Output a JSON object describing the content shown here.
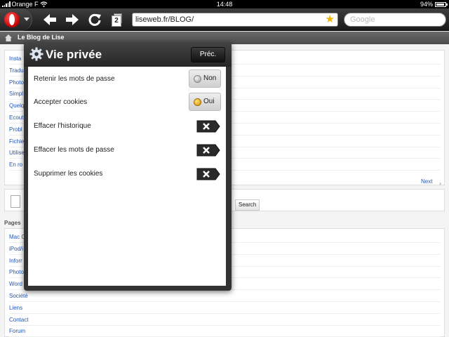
{
  "status_bar": {
    "carrier": "Orange F",
    "time": "14:48",
    "battery": "94%",
    "battery_level": 0.94
  },
  "toolbar": {
    "tab_count": "2",
    "url": "liseweb.fr/BLOG/",
    "search_placeholder": "Google"
  },
  "tabbar": {
    "title": "Le Blog de Lise"
  },
  "page": {
    "links": [
      "Insta",
      "Tradu",
      "Photo",
      "Simpl",
      "Quelq",
      "Ecout",
      "Probl",
      "Fichie",
      "Utilise",
      "En ro"
    ],
    "next_label": "Next",
    "search_button": "Search",
    "pages_heading": "Pages",
    "page_links": [
      "Mac O",
      "iPod/i",
      "Inforr",
      "Photo",
      "Word",
      "Société",
      "Liens",
      "Contact",
      "Forum"
    ]
  },
  "popup": {
    "title": "Vie privée",
    "back_label": "Préc.",
    "settings": [
      {
        "label": "Retenir les mots de passe",
        "type": "toggle",
        "state_label": "Non",
        "on": false
      },
      {
        "label": "Accepter cookies",
        "type": "toggle",
        "state_label": "Oui",
        "on": true
      },
      {
        "label": "Effacer l'historique",
        "type": "clear"
      },
      {
        "label": "Effacer les mots de passe",
        "type": "clear"
      },
      {
        "label": "Supprimer les cookies",
        "type": "clear"
      }
    ]
  },
  "colors": {
    "link": "#2456b8",
    "toggle_on": "#e0a100",
    "toggle_off": "#9a9a9a",
    "opera_red": "#c40000"
  }
}
